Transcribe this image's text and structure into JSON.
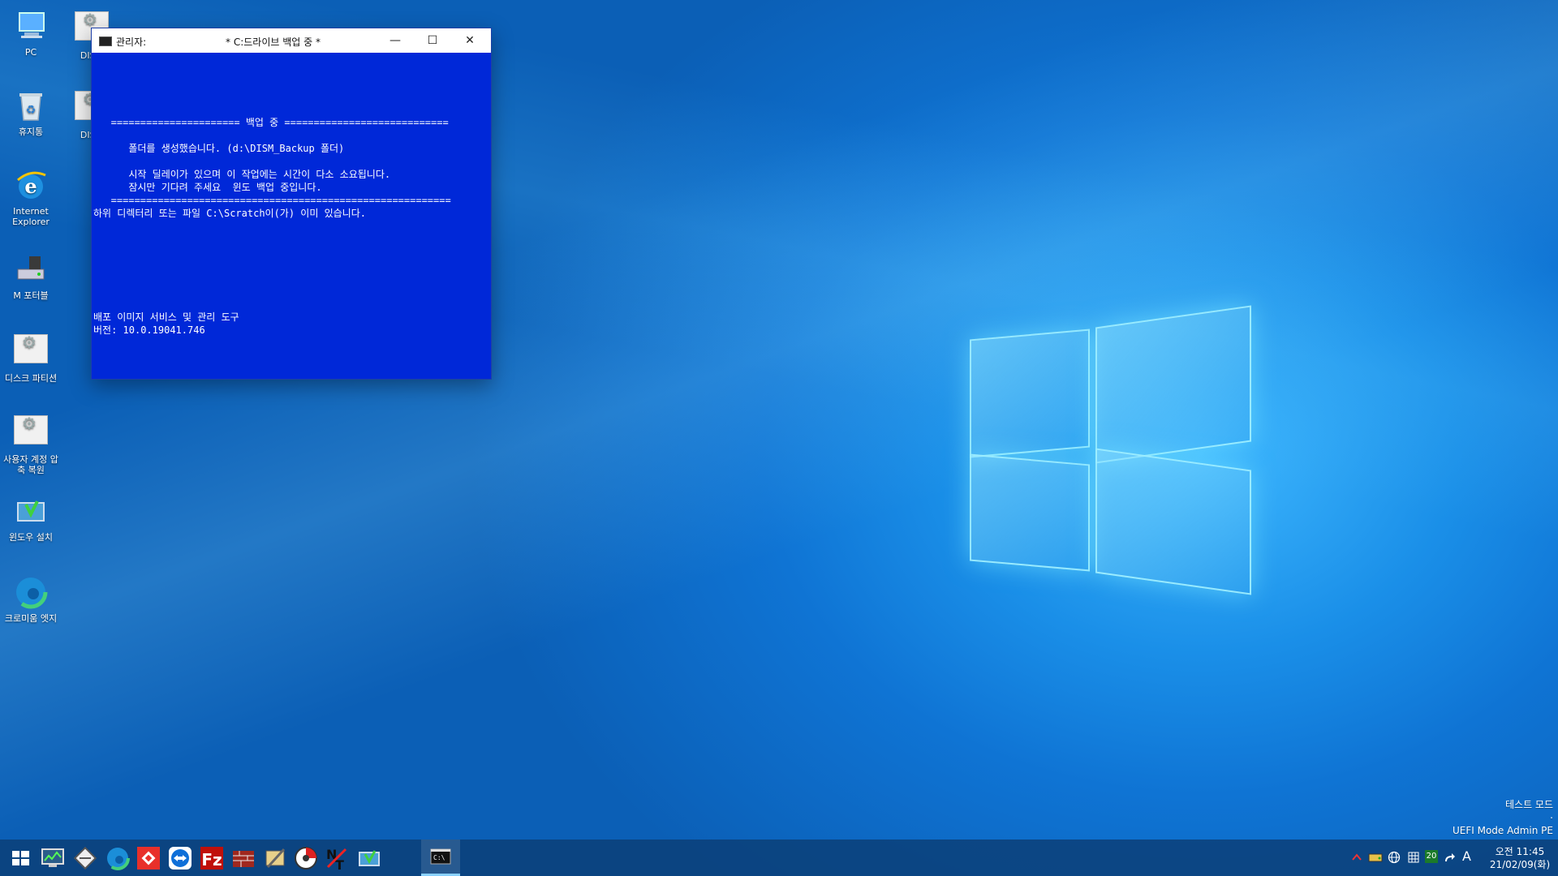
{
  "desktop": {
    "icons": [
      {
        "label": "PC",
        "icon": "pc-icon"
      },
      {
        "label": "DISM",
        "icon": "settings-app-icon"
      },
      {
        "label": "휴지통",
        "icon": "recycle-bin-icon"
      },
      {
        "label": "DISM",
        "icon": "settings-app-icon"
      },
      {
        "label": "Internet Explorer",
        "icon": "internet-explorer-icon"
      },
      {
        "label": "M 포터블",
        "icon": "portable-drive-icon"
      },
      {
        "label": "디스크 파티션",
        "icon": "settings-app-icon"
      },
      {
        "label": "사용자 계정 압축 복원",
        "icon": "settings-app-icon"
      },
      {
        "label": "윈도우 설치",
        "icon": "windows-setup-icon"
      },
      {
        "label": "크로미움 엣지",
        "icon": "edge-icon"
      }
    ]
  },
  "cmd_window": {
    "title_prefix": "관리자:",
    "title": "* C:드라이브 백업 중 *",
    "minimize": "—",
    "maximize": "☐",
    "close": "✕",
    "lines": [
      "",
      "",
      "",
      "   ====================== 백업 중 ============================",
      "",
      "      폴더를 생성했습니다. (d:\\DISM_Backup 폴더)",
      "",
      "      시작 딜레이가 있으며 이 작업에는 시간이 다소 소요됩니다.",
      "      잠시만 기다려 주세요  윈도 백업 중입니다.",
      "   ==========================================================",
      "하위 디렉터리 또는 파일 C:\\Scratch이(가) 이미 있습니다.",
      "",
      "",
      "",
      "",
      "",
      "",
      "",
      "배포 이미지 서비스 및 관리 도구",
      "버전: 10.0.19041.746"
    ]
  },
  "watermark": {
    "line1": "테스트 모드",
    "line2": ".",
    "line3": "UEFI Mode Admin PE"
  },
  "taskbar": {
    "start_icon": "windows-start-icon",
    "pinned": [
      "monitor-icon",
      "tool-icon",
      "edge-icon",
      "anydesk-icon",
      "teamviewer-icon",
      "filezilla-icon",
      "firewall-icon",
      "utility-icon",
      "disk-tool-icon",
      "notepad-plus-icon",
      "windows-setup-icon"
    ],
    "active": "cmd-icon",
    "tray": {
      "badge": "20",
      "ime": "A"
    },
    "clock": {
      "time": "오전 11:45",
      "date": "21/02/09(화)"
    }
  }
}
